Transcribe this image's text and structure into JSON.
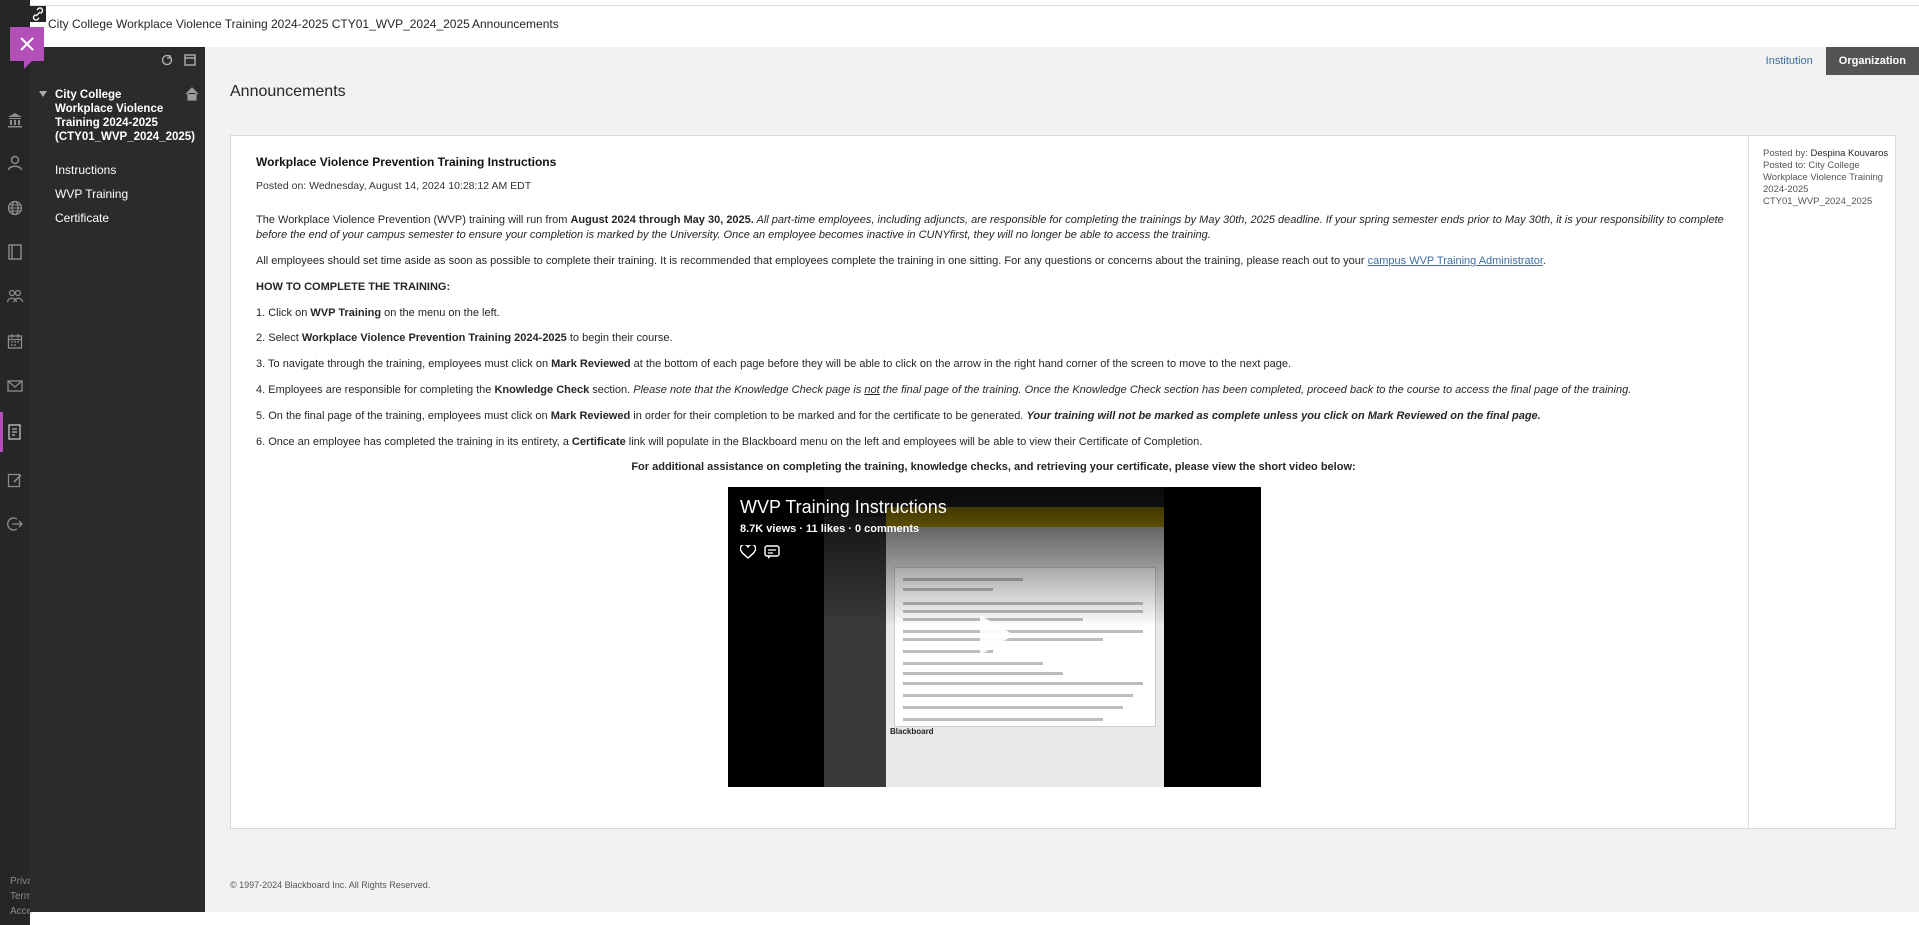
{
  "breadcrumb": {
    "course": "City College Workplace Violence Training 2024-2025 CTY01_WVP_2024_2025",
    "page": "Announcements"
  },
  "rail": {
    "icons": [
      "institution-icon",
      "profile-icon",
      "globe-icon",
      "courses-icon",
      "organizations-icon",
      "calendar-icon",
      "messages-icon",
      "grades-icon",
      "tools-icon",
      "logout-icon"
    ],
    "footer": [
      "Priva",
      "Term",
      "Acce"
    ],
    "accent_color": "#b34fb9"
  },
  "course_menu": {
    "title": "City College Workplace Violence Training 2024-2025 (CTY01_WVP_2024_2025)",
    "items": [
      {
        "label": "Instructions"
      },
      {
        "label": "WVP Training"
      },
      {
        "label": "Certificate"
      }
    ]
  },
  "context_tabs": {
    "institution": "Institution",
    "organization": "Organization"
  },
  "main": {
    "title": "Announcements",
    "copyright": "© 1997-2024 Blackboard Inc. All Rights Reserved."
  },
  "announcement": {
    "title": "Workplace Violence Prevention Training Instructions",
    "posted_on": "Posted on: Wednesday, August 14, 2024 10:28:12 AM EDT",
    "p1": {
      "a": "The Workplace Violence Prevention (WVP) training will run from ",
      "b": "August 2024 through May 30, 2025.",
      "c": " All part-time employees, including adjuncts, are responsible for completing the trainings by May 30th, 2025 deadline. If your spring semester ends prior to May 30th, it is your responsibility to complete before the end of your campus semester to ensure your completion is marked by the University. Once an employee becomes inactive in CUNYfirst, they will no longer be able to access the training."
    },
    "p2": {
      "a": "All employees should set time aside as soon as possible to complete their training. It is recommended that employees complete the training in one sitting. For any questions or concerns about the training, please reach out to your ",
      "link": "campus WVP Training Administrator",
      "c": "."
    },
    "how_heading": "HOW TO COMPLETE THE TRAINING:",
    "steps": [
      {
        "a": "1. Click on ",
        "b": "WVP Training",
        "c": " on the menu on the left."
      },
      {
        "a": "2. Select ",
        "b": "Workplace Violence Prevention Training 2024-2025",
        "c": " to begin their course."
      },
      {
        "a": "3. To navigate through the training, employees must click on ",
        "b": "Mark Reviewed",
        "c": " at the bottom of each page before they will be able to click on the arrow in the right hand corner of the screen to move to the next page."
      },
      {
        "a": "4. Employees are responsible for completing the ",
        "b": "Knowledge Check",
        "c": " section. ",
        "i1": "Please note that the Knowledge Check page is ",
        "u": "not",
        "i2": " the final page of the training. Once the Knowledge Check section has been completed, proceed back to the course to access the final page of the training."
      },
      {
        "a": "5. On the final page of the training, employees must click on ",
        "b": "Mark Reviewed",
        "c": " in order for their completion to be marked and for the certificate to be generated. ",
        "bi": "Your training will not be marked as complete unless you click on Mark Reviewed on the final page."
      },
      {
        "a": "6. Once an employee has completed the training in its entirety, a ",
        "b": "Certificate",
        "c": " link will populate in the Blackboard menu on the left and employees will be able to view their Certificate of Completion."
      }
    ],
    "assist": "For additional assistance on completing the training, knowledge checks, and retrieving your certificate, please view the short video below:",
    "meta": {
      "posted_by_label": "Posted by:",
      "posted_by": "Despina Kouvaros",
      "posted_to_label": "Posted to:",
      "posted_to": "City College Workplace Violence Training 2024-2025 CTY01_WVP_2024_2025"
    }
  },
  "video": {
    "title": "WVP Training Instructions",
    "stats": "8.7K views · 11 likes · 0 comments",
    "screen_footer": "Blackboard"
  }
}
